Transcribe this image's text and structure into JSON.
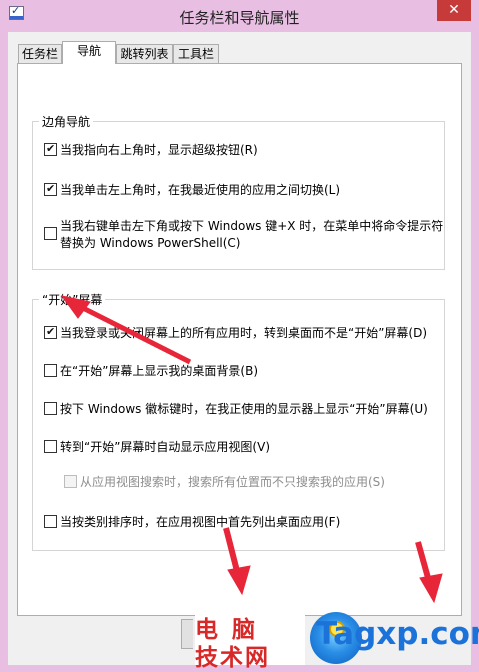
{
  "window": {
    "title": "任务栏和导航属性",
    "close_glyph": "✕"
  },
  "tabs": [
    {
      "label": "任务栏",
      "active": false
    },
    {
      "label": "导航",
      "active": true
    },
    {
      "label": "跳转列表",
      "active": false
    },
    {
      "label": "工具栏",
      "active": false
    }
  ],
  "corner_navigation": {
    "label": "边角导航",
    "options": [
      {
        "text": "当我指向右上角时，显示超级按钮(R)",
        "checked": true
      },
      {
        "text": "当我单击左上角时，在我最近使用的应用之间切换(L)",
        "checked": true
      },
      {
        "text": "当我右键单击左下角或按下 Windows 键+X 时，在菜单中将命令提示符",
        "text2": "替换为 Windows PowerShell(C)",
        "checked": false
      }
    ]
  },
  "start_screen": {
    "label": "“开始”屏幕",
    "options": [
      {
        "text": "当我登录或关闭屏幕上的所有应用时，转到桌面而不是“开始”屏幕(D)",
        "checked": true
      },
      {
        "text": "在“开始”屏幕上显示我的桌面背景(B)",
        "checked": false
      },
      {
        "text": "按下 Windows 徽标键时，在我正使用的显示器上显示“开始”屏幕(U)",
        "checked": false
      },
      {
        "text": "转到“开始”屏幕时自动显示应用视图(V)",
        "checked": false
      },
      {
        "text": "从应用视图搜索时，搜索所有位置而不只搜索我的应用(S)",
        "checked": false,
        "disabled": true
      },
      {
        "text": "当按类别排序时，在应用视图中首先列出桌面应用(F)",
        "checked": false
      }
    ]
  },
  "watermark": {
    "line1": "电脑",
    "line2": "技术网",
    "domain": "Tagxp.com"
  },
  "colors": {
    "frame": "#e8bfe3",
    "close_button": "#c73a3a",
    "annotation_arrow": "#e8263a",
    "watermark_red": "#d82828",
    "watermark_blue": "#1b72d8"
  }
}
